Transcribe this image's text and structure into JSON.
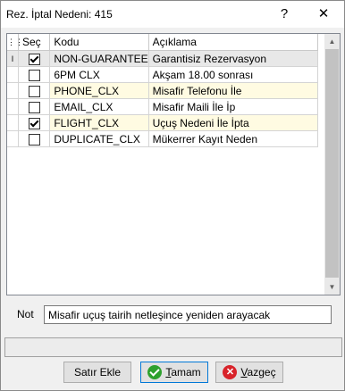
{
  "window": {
    "title": "Rez. İptal Nedeni: 415",
    "help_glyph": "?",
    "close_glyph": "✕"
  },
  "grid": {
    "indicator_header": "⋮⋮",
    "columns": {
      "sec": "Seç",
      "kodu": "Kodu",
      "aciklama": "Açıklama"
    },
    "rows": [
      {
        "indicator": "I",
        "checked": true,
        "kodu": "NON-GUARANTEE",
        "aciklama": "Garantisiz Rezervasyon"
      },
      {
        "indicator": "",
        "checked": false,
        "kodu": "6PM CLX",
        "aciklama": "Akşam 18.00 sonrası"
      },
      {
        "indicator": "",
        "checked": false,
        "kodu": "PHONE_CLX",
        "aciklama": "Misafir Telefonu İle"
      },
      {
        "indicator": "",
        "checked": false,
        "kodu": "EMAIL_CLX",
        "aciklama": "Misafir Maili İle İp"
      },
      {
        "indicator": "",
        "checked": true,
        "kodu": "FLIGHT_CLX",
        "aciklama": "Uçuş Nedeni İle İpta"
      },
      {
        "indicator": "",
        "checked": false,
        "kodu": "DUPLICATE_CLX",
        "aciklama": "Mükerrer Kayıt Neden"
      }
    ]
  },
  "note": {
    "label": "Not",
    "value": "Misafir uçuş tairih netleşince yeniden arayacak"
  },
  "status": {
    "text": ""
  },
  "buttons": {
    "add_row": "Satır Ekle",
    "ok_prefix": "T",
    "ok_rest": "amam",
    "cancel_prefix": "V",
    "cancel_rest": "azgeç"
  },
  "colors": {
    "highlight_row": "#fffbe2",
    "current_row": "#e8e8e8",
    "ok_icon": "#2ea12e",
    "cancel_icon": "#d8232a"
  }
}
